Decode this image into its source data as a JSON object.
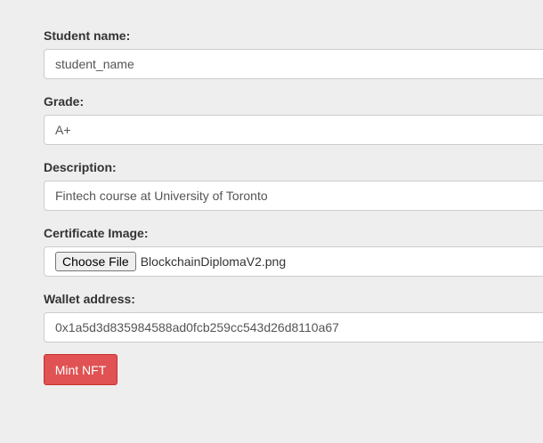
{
  "form": {
    "student_name": {
      "label": "Student name:",
      "value": "student_name"
    },
    "grade": {
      "label": "Grade:",
      "value": "A+"
    },
    "description": {
      "label": "Description:",
      "value": "Fintech course at University of Toronto"
    },
    "certificate_image": {
      "label": "Certificate Image:",
      "button_label": "Choose File",
      "file_name": "BlockchainDiplomaV2.png"
    },
    "wallet_address": {
      "label": "Wallet address:",
      "value": "0x1a5d3d835984588ad0fcb259cc543d26d8110a67"
    },
    "submit": {
      "label": "Mint NFT",
      "color": "#e05253"
    }
  }
}
